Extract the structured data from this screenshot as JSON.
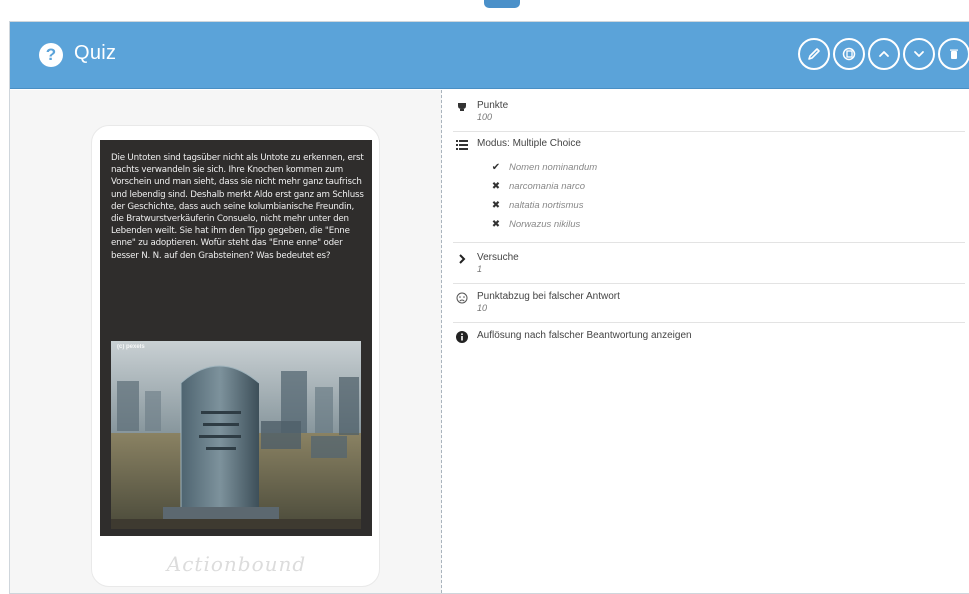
{
  "header": {
    "title": "Quiz",
    "help_icon": "question-circle-icon",
    "actions": [
      {
        "name": "edit-button",
        "icon": "pencil-icon"
      },
      {
        "name": "copy-button",
        "icon": "copy-icon"
      },
      {
        "name": "move-up-button",
        "icon": "chevron-up-icon"
      },
      {
        "name": "move-down-button",
        "icon": "chevron-down-icon"
      },
      {
        "name": "delete-button",
        "icon": "trash-icon"
      }
    ]
  },
  "preview": {
    "question_text": "Die Untoten sind tagsüber nicht als Untote zu erkennen, erst nachts verwandeln sie sich. Ihre Knochen kommen zum Vorschein und man sieht, dass sie nicht mehr ganz taufrisch und lebendig sind. Deshalb merkt Aldo erst ganz am Schluss der Geschichte, dass auch seine kolumbianische Freundin, die Bratwurstverkäuferin Consuelo, nicht mehr unter den Lebenden weilt. Sie hat ihm den Tipp gegeben, die \"Enne enne\" zu adoptieren. Wofür steht das \"Enne enne\" oder besser N. N. auf den Grabsteinen? Was bedeutet es?",
    "image_watermark": "(c) pexels",
    "brand": "Actionbound"
  },
  "details": {
    "points": {
      "label": "Punkte",
      "value": "100"
    },
    "mode": {
      "label": "Modus: Multiple Choice",
      "options": [
        {
          "text": "Nomen nominandum",
          "correct": true
        },
        {
          "text": "narcomania narco",
          "correct": false
        },
        {
          "text": "naltatia nortismus",
          "correct": false
        },
        {
          "text": "Norwazus nikilus",
          "correct": false
        }
      ]
    },
    "attempts": {
      "label": "Versuche",
      "value": "1"
    },
    "penalty": {
      "label": "Punktabzug bei falscher Antwort",
      "value": "10"
    },
    "solution": {
      "label": "Auflösung nach falscher Beantwortung anzeigen"
    }
  },
  "colors": {
    "header": "#5ba3d9",
    "card": "#2f2d2c"
  }
}
